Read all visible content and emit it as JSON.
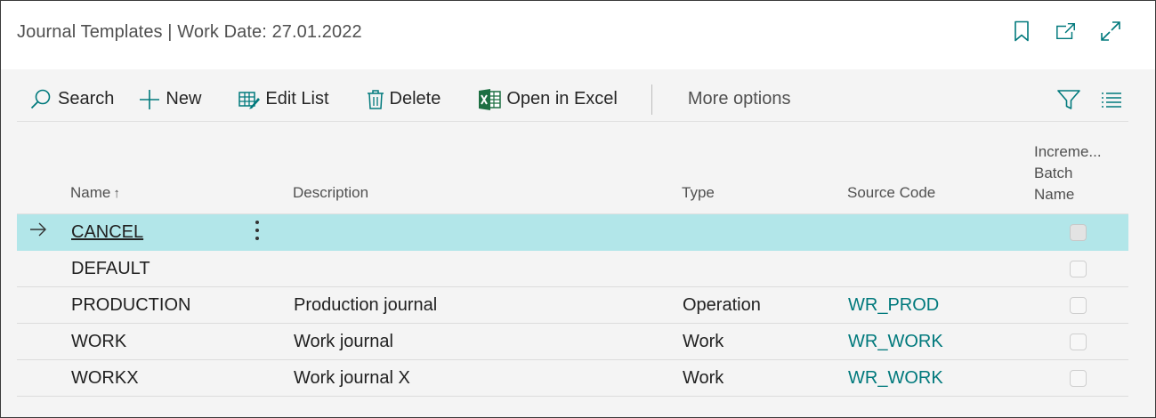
{
  "header": {
    "title": "Journal Templates | Work Date: 27.01.2022",
    "actions": [
      {
        "icon": "bookmark-icon"
      },
      {
        "icon": "open-new-window-icon"
      },
      {
        "icon": "expand-icon"
      }
    ]
  },
  "toolbar": {
    "search_label": "Search",
    "new_label": "New",
    "edit_list_label": "Edit List",
    "delete_label": "Delete",
    "open_in_excel_label": "Open in Excel",
    "more_options_label": "More options",
    "filter_icon": "filter-icon",
    "list_view_icon": "list-view-icon"
  },
  "table": {
    "columns": {
      "name": "Name",
      "name_sort": "↑",
      "description": "Description",
      "type": "Type",
      "source_code": "Source Code",
      "increment_line1": "Increme...",
      "increment_line2": "Batch",
      "increment_line3": "Name"
    },
    "rows": [
      {
        "name": "CANCEL",
        "description": "",
        "type": "",
        "source_code": "",
        "increment_batch_name": false,
        "selected": true
      },
      {
        "name": "DEFAULT",
        "description": "",
        "type": "",
        "source_code": "",
        "increment_batch_name": false
      },
      {
        "name": "PRODUCTION",
        "description": "Production journal",
        "type": "Operation",
        "source_code": "WR_PROD",
        "increment_batch_name": false
      },
      {
        "name": "WORK",
        "description": "Work journal",
        "type": "Work",
        "source_code": "WR_WORK",
        "increment_batch_name": false
      },
      {
        "name": "WORKX",
        "description": "Work journal X",
        "type": "Work",
        "source_code": "WR_WORK",
        "increment_batch_name": false
      }
    ]
  },
  "colors": {
    "accent": "#00797c",
    "selected_row": "#b2e6e9"
  }
}
